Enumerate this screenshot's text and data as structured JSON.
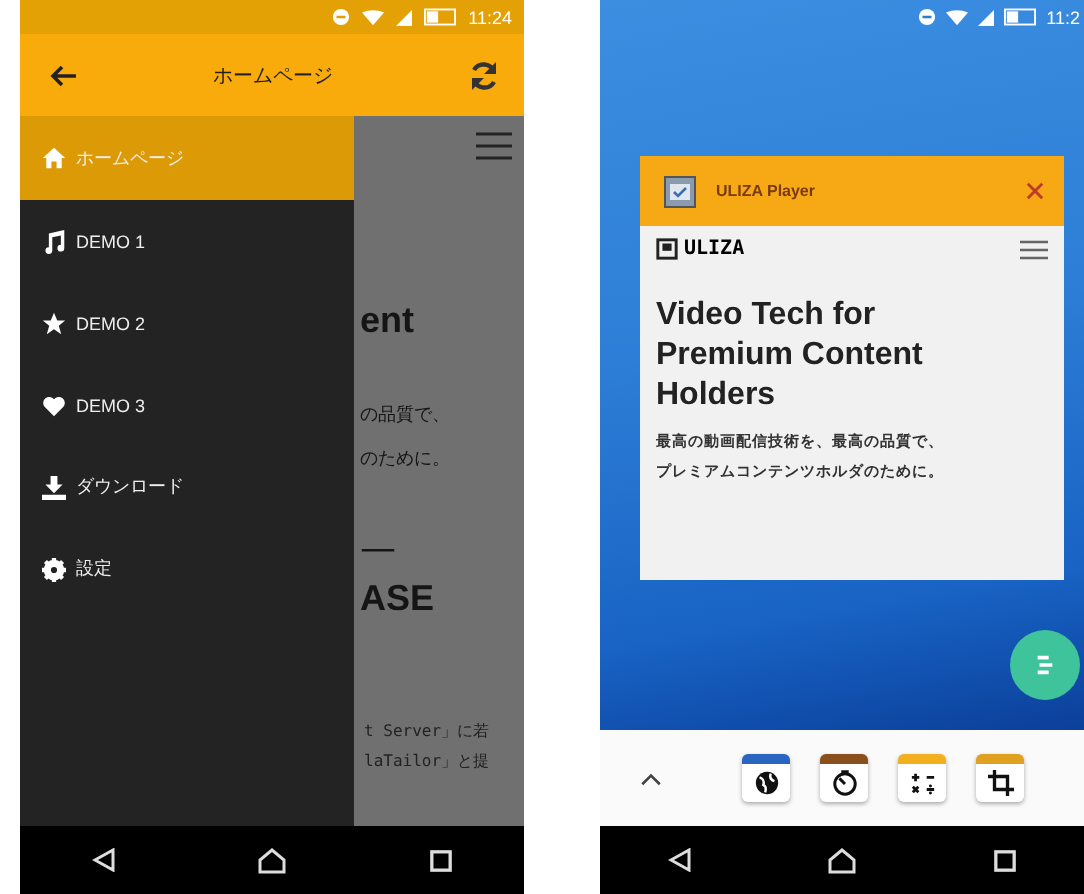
{
  "left_phone": {
    "status_bar": {
      "time": "11:24"
    },
    "app_bar": {
      "title": "ホームページ"
    },
    "background_page": {
      "texts": [
        {
          "kind": "heading",
          "text": "ent"
        },
        {
          "kind": "body",
          "text": "の品質で、"
        },
        {
          "kind": "body",
          "text": "のために。"
        },
        {
          "kind": "rule",
          "text": "—"
        },
        {
          "kind": "heading",
          "text": "ASE"
        },
        {
          "kind": "small",
          "text": "t Server」に若"
        },
        {
          "kind": "small",
          "text": "laTailor」と提"
        }
      ]
    },
    "drawer": {
      "items": [
        {
          "kind": "home",
          "label": "ホームページ",
          "selected": true
        },
        {
          "kind": "music",
          "label": "DEMO 1",
          "selected": false
        },
        {
          "kind": "star",
          "label": "DEMO 2",
          "selected": false
        },
        {
          "kind": "heart",
          "label": "DEMO 3",
          "selected": false
        },
        {
          "kind": "download",
          "label": "ダウンロード",
          "selected": false
        },
        {
          "kind": "gear",
          "label": "設定",
          "selected": false
        }
      ]
    }
  },
  "right_phone": {
    "status_bar": {
      "time": "11:2"
    },
    "recent_card": {
      "app_name": "ULIZA Player",
      "logo": "ULIZA",
      "headline_lines": [
        "Video Tech for",
        "Premium Content",
        "Holders"
      ],
      "subtitle_lines": [
        "最高の動画配信技術を、最高の品質で、",
        "プレミアムコンテンツホルダのために。"
      ]
    },
    "dock": {
      "apps": [
        {
          "kind": "globe",
          "color": "#2a66c0"
        },
        {
          "kind": "timer",
          "color": "#8a4f1c"
        },
        {
          "kind": "calculator",
          "color": "#f2b01e"
        },
        {
          "kind": "crop",
          "color": "#e0a020"
        }
      ]
    }
  }
}
